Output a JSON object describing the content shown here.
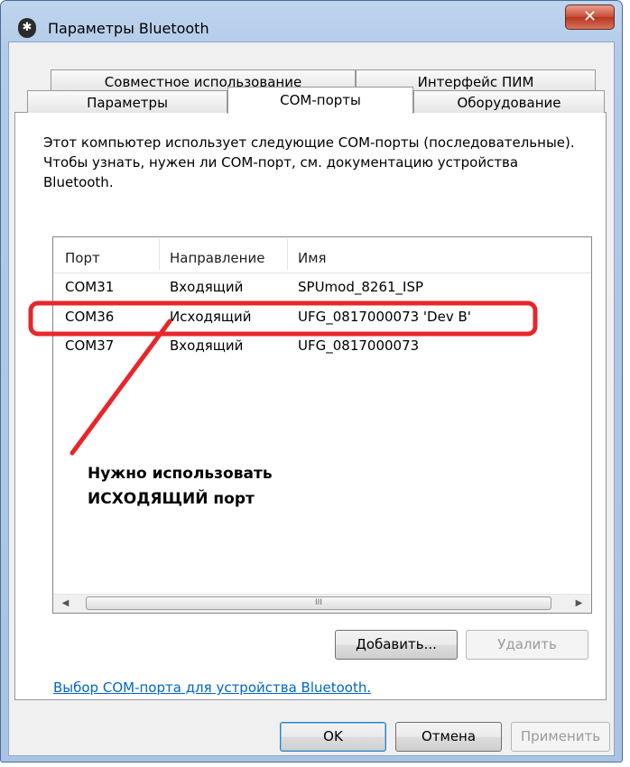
{
  "window": {
    "title": "Параметры Bluetooth",
    "app_icon_glyph": "✱",
    "close_glyph": "✕"
  },
  "tabs": {
    "row1": [
      "Совместное использование",
      "Интерфейс ПИМ"
    ],
    "row2": [
      "Параметры",
      "COM-порты",
      "Оборудование"
    ],
    "active": "COM-порты"
  },
  "description": "Этот компьютер использует следующие COM-порты (последовательные). Чтобы узнать, нужен ли COM-порт, см. документацию устройства Bluetooth.",
  "ports_table": {
    "columns": [
      "Порт",
      "Направление",
      "Имя"
    ],
    "rows": [
      {
        "port": "COM31",
        "direction": "Входящий",
        "name": "SPUmod_8261_ISP"
      },
      {
        "port": "COM36",
        "direction": "Исходящий",
        "name": "UFG_0817000073 'Dev B'"
      },
      {
        "port": "COM37",
        "direction": "Входящий",
        "name": "UFG_0817000073"
      }
    ],
    "highlighted_row": "COM36"
  },
  "scrollbar": {
    "left": "◀",
    "right": "▶",
    "grip": "III"
  },
  "annotation": {
    "line1": "Нужно использовать",
    "line2": "ИСХОДЯЩИЙ порт",
    "color": "#e8262a"
  },
  "buttons": {
    "add": "Добавить...",
    "remove": "Удалить",
    "ok": "OK",
    "cancel": "Отмена",
    "apply": "Применить"
  },
  "link": "Выбор COM-порта для устройства Bluetooth."
}
